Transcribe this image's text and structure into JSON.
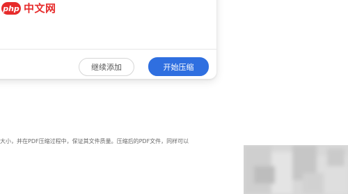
{
  "watermark": {
    "logo_badge": "php",
    "logo_text": "中文网"
  },
  "dialog": {
    "continue_button_label": "继续添加",
    "start_button_label": "开始压缩"
  },
  "article": {
    "paragraph_text": "大小，并在PDF压缩过程中，保证其文件质量。压缩后的PDF文件，同样可以"
  },
  "colors": {
    "accent": "#2f6fe0",
    "watermark": "#e62b2b"
  }
}
